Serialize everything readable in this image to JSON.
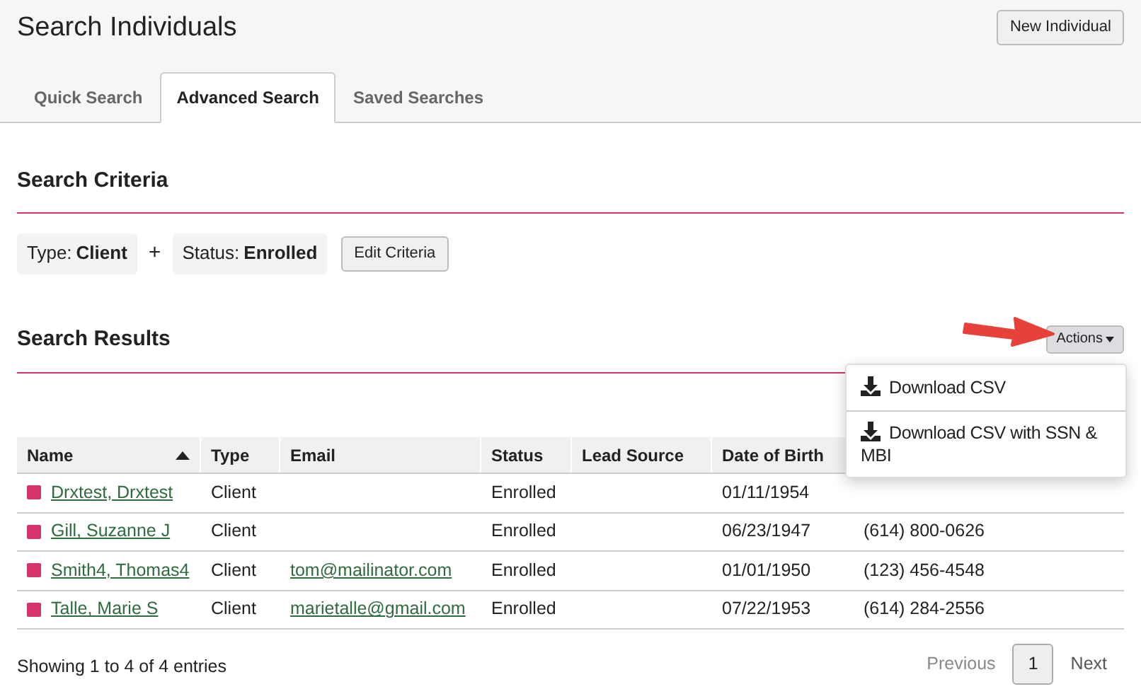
{
  "page": {
    "title": "Search Individuals",
    "new_button": "New Individual"
  },
  "tabs": [
    {
      "label": "Quick Search",
      "selected": false
    },
    {
      "label": "Advanced Search",
      "selected": true
    },
    {
      "label": "Saved Searches",
      "selected": false
    }
  ],
  "criteria": {
    "heading": "Search Criteria",
    "chips": [
      {
        "label": "Type:",
        "value": "Client"
      },
      {
        "label": "Status:",
        "value": "Enrolled"
      }
    ],
    "joiner": "+",
    "edit_button": "Edit Criteria"
  },
  "results": {
    "heading": "Search Results",
    "actions_button": "Actions",
    "menu": [
      "Download CSV",
      "Download CSV with SSN & MBI"
    ]
  },
  "table": {
    "columns": [
      {
        "label": "Name",
        "sorted": true
      },
      {
        "label": "Type",
        "sorted": false
      },
      {
        "label": "Email",
        "sorted": false
      },
      {
        "label": "Status",
        "sorted": false
      },
      {
        "label": "Lead Source",
        "sorted": false
      },
      {
        "label": "Date of Birth",
        "sorted": false
      }
    ],
    "rows": [
      {
        "name": "Drxtest, Drxtest",
        "type": "Client",
        "status": "Enrolled",
        "date_of_birth": "01/11/1954"
      },
      {
        "name": "Gill, Suzanne J",
        "type": "Client",
        "status": "Enrolled",
        "date_of_birth": "06/23/1947",
        "column_7": "(614) 800-0626"
      },
      {
        "name": "Smith4, Thomas4",
        "type": "Client",
        "email": "tom@mailinator.com",
        "status": "Enrolled",
        "date_of_birth": "01/01/1950",
        "column_7": "(123) 456-4548"
      },
      {
        "name": "Talle, Marie S",
        "type": "Client",
        "email": "marietalle@gmail.com",
        "status": "Enrolled",
        "date_of_birth": "07/22/1953",
        "column_7": "(614) 284-2556"
      }
    ]
  },
  "footer": {
    "summary": "Showing 1 to 4 of 4 entries",
    "pagination": [
      {
        "label": "Previous",
        "kind": "prev",
        "disabled": true
      },
      {
        "label": "1",
        "kind": "page",
        "selected": true
      },
      {
        "label": "Next",
        "kind": "next",
        "disabled": false
      }
    ]
  }
}
